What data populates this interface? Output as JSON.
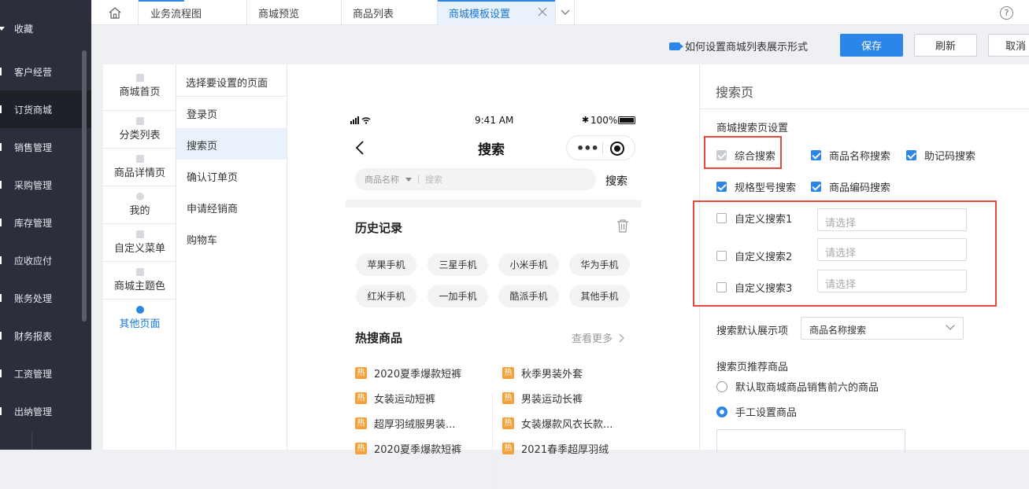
{
  "sidebar": {
    "items": [
      {
        "label": "收藏"
      },
      {
        "label": "客户经营"
      },
      {
        "label": "订货商城"
      },
      {
        "label": "销售管理"
      },
      {
        "label": "采购管理"
      },
      {
        "label": "库存管理"
      },
      {
        "label": "应收应付"
      },
      {
        "label": "账务处理"
      },
      {
        "label": "财务报表"
      },
      {
        "label": "工资管理"
      },
      {
        "label": "出纳管理"
      }
    ]
  },
  "tabs": [
    {
      "label": "业务流程图"
    },
    {
      "label": "商城预览"
    },
    {
      "label": "商品列表"
    },
    {
      "label": "商城模板设置"
    }
  ],
  "toolbar": {
    "help_link": "如何设置商城列表展示形式",
    "save": "保存",
    "refresh": "刷新",
    "cancel": "取消"
  },
  "page_list": [
    {
      "label": "商城首页"
    },
    {
      "label": "分类列表"
    },
    {
      "label": "商品详情页"
    },
    {
      "label": "我的"
    },
    {
      "label": "自定义菜单"
    },
    {
      "label": "商城主题色"
    },
    {
      "label": "其他页面"
    }
  ],
  "sub_pages": {
    "title": "选择要设置的页面",
    "items": [
      {
        "label": "登录页"
      },
      {
        "label": "搜索页"
      },
      {
        "label": "确认订单页"
      },
      {
        "label": "申请经销商"
      },
      {
        "label": "购物车"
      }
    ]
  },
  "phone": {
    "time": "9:41 AM",
    "battery": "100%",
    "title": "搜索",
    "search_category": "商品名称",
    "search_placeholder": "搜索",
    "search_button": "搜索",
    "history_title": "历史记录",
    "history_chips": [
      "苹果手机",
      "三星手机",
      "小米手机",
      "华为手机",
      "红米手机",
      "一加手机",
      "酷派手机",
      "其他手机"
    ],
    "hot_title": "热搜商品",
    "hot_more": "查看更多",
    "hot_badge": "热",
    "hot_left": [
      "2020夏季爆款短裤",
      "女装运动短裤",
      "超厚羽绒服男装...",
      "2020夏季爆款短裤"
    ],
    "hot_right": [
      "秋季男装外套",
      "男装运动长裤",
      "女装爆款风衣长款...",
      "2021春季超厚羽绒"
    ]
  },
  "settings": {
    "header": "搜索页",
    "section_title": "商城搜索页设置",
    "checkboxes": [
      {
        "label": "综合搜索",
        "state": "checked-disabled"
      },
      {
        "label": "商品名称搜索",
        "state": "checked"
      },
      {
        "label": "助记码搜索",
        "state": "checked"
      },
      {
        "label": "规格型号搜索",
        "state": "checked"
      },
      {
        "label": "商品编码搜索",
        "state": "checked"
      }
    ],
    "custom": [
      {
        "label": "自定义搜索1",
        "placeholder": "请选择"
      },
      {
        "label": "自定义搜索2",
        "placeholder": "请选择"
      },
      {
        "label": "自定义搜索3",
        "placeholder": "请选择"
      }
    ],
    "default_label": "搜索默认展示项",
    "default_value": "商品名称搜索",
    "recommend_title": "搜索页推荐商品",
    "recommend_options": [
      {
        "label": "默认取商城商品销售前六的商品",
        "selected": false
      },
      {
        "label": "手工设置商品",
        "selected": true
      }
    ]
  },
  "colors": {
    "accent": "#2b86e8",
    "sidebar": "#2c2f3b",
    "highlight_box": "#e44a3c"
  }
}
